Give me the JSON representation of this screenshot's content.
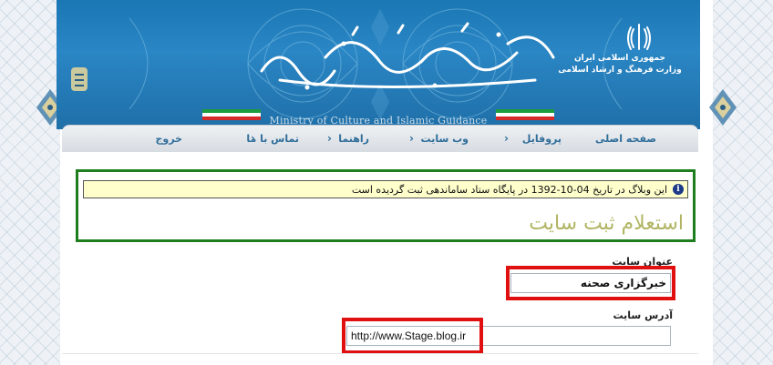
{
  "header": {
    "org_line1": "جمهوری اسلامی ایران",
    "org_line2": "وزارت فرهنگ و ارشاد اسلامی",
    "ministry_en": "Ministry of Culture and Islamic Guidance"
  },
  "nav": {
    "items": [
      {
        "label": "صفحه اصلی"
      },
      {
        "label": "پروفایل"
      },
      {
        "label": "وب سایت"
      },
      {
        "label": "راهنما"
      },
      {
        "label": "تماس با ما"
      },
      {
        "label": "خروج"
      }
    ],
    "separator": "›"
  },
  "notice": {
    "icon": "i",
    "text": "این وبلاگ در تاریخ 04-10-1392 در پایگاه ستاد ساماندهی ثبت گردیده است"
  },
  "page": {
    "title": "استعلام ثبت سایت"
  },
  "form": {
    "site_title_label": "عنوان سایت",
    "site_title_value": "خبرگزاری صحنه",
    "site_address_label": "آدرس سایت",
    "site_address_value": "http://www.Stage.blog.ir"
  },
  "colors": {
    "header_blue": "#1f78b8",
    "nav_text": "#2f6d99",
    "title_olive": "#b1b563",
    "highlight_green": "#1e7e1e",
    "highlight_red": "#e01010",
    "notice_bg": "#ffffcc"
  }
}
